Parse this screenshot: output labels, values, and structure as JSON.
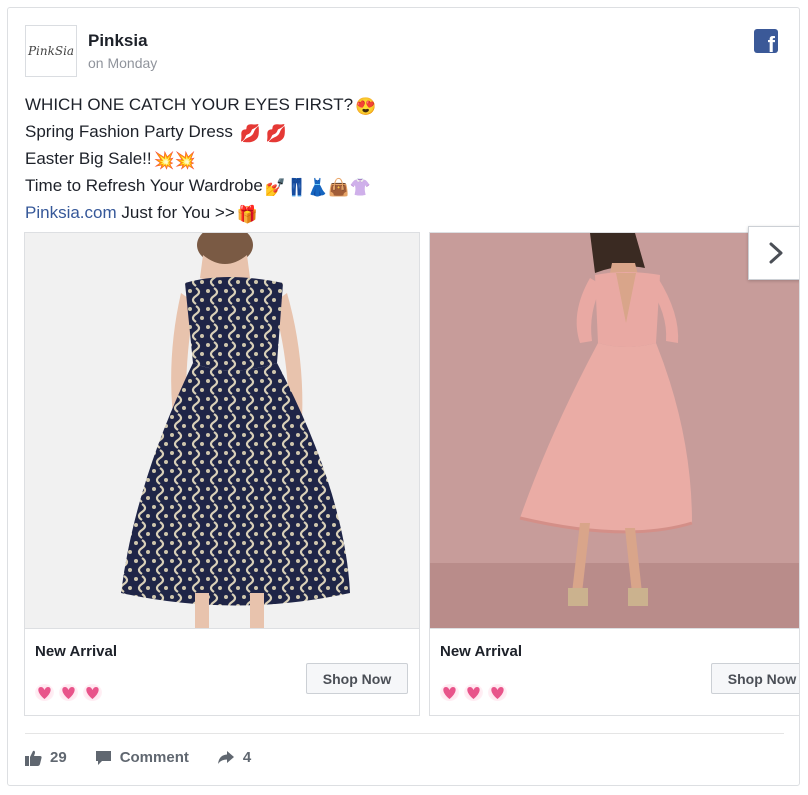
{
  "post": {
    "page_name": "Pinksia",
    "time": "on Monday",
    "avatar_text": "PinkSia",
    "lines": [
      "WHICH ONE CATCH YOUR EYES FIRST?",
      "Spring Fashion Party Dress",
      "Easter Big Sale!!",
      "Time to Refresh Your Wardrobe"
    ],
    "link_text": "Pinksia.com",
    "link_suffix": " Just for You >>",
    "emoji": {
      "line1": "😍",
      "line2": "💋 💋",
      "line3": "💥💥",
      "line4": "💅👖👗👜👚",
      "line5": "🎁"
    }
  },
  "cards": [
    {
      "title": "New Arrival",
      "cta": "Shop Now",
      "image": "navy-lace-dress-photo",
      "rating_icons": [
        "heart-icon",
        "heart-icon",
        "heart-icon"
      ]
    },
    {
      "title": "New Arrival",
      "cta": "Shop Now",
      "image": "pink-midi-dress-photo",
      "rating_icons": [
        "heart-icon",
        "heart-icon",
        "heart-icon"
      ]
    }
  ],
  "actions": {
    "likes": "29",
    "comment_label": "Comment",
    "shares": "4"
  },
  "colors": {
    "facebook_blue": "#3b5998",
    "link": "#365899",
    "heart_pink": "#e8548a",
    "navy_dress": "#1f2547",
    "pink_dress": "#e9a9a3"
  }
}
